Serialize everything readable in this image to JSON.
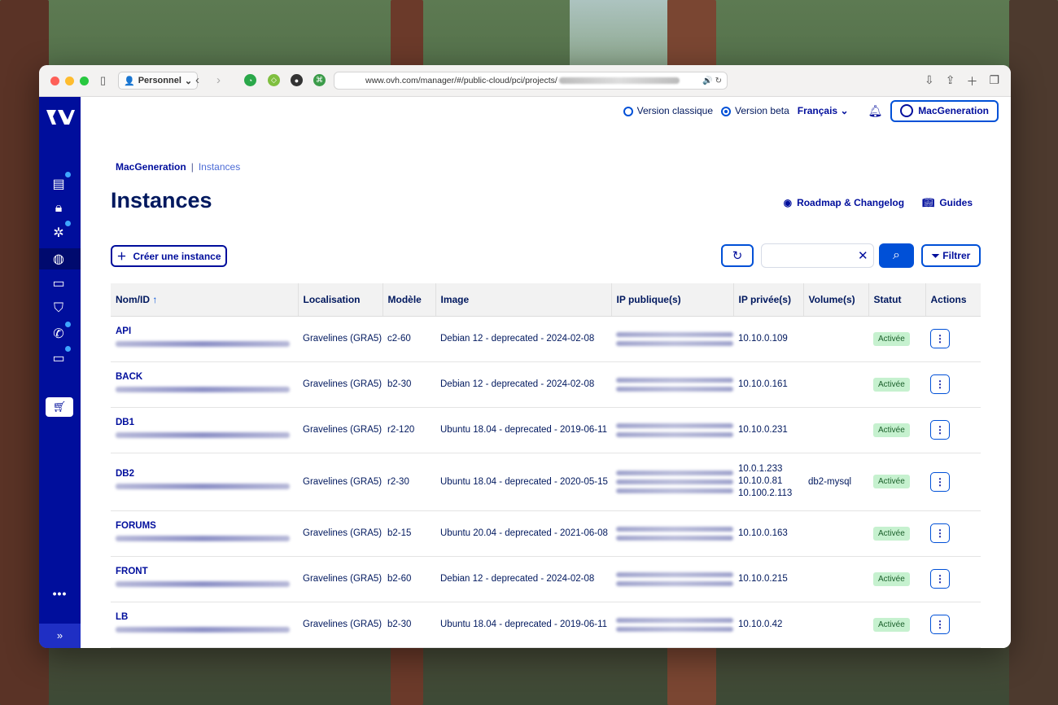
{
  "browser": {
    "profile": "Personnel",
    "url": "www.ovh.com/manager/#/public-cloud/pci/projects/"
  },
  "topbar": {
    "version_classic": "Version classique",
    "version_beta": "Version beta",
    "language": "Français",
    "account": "MacGeneration"
  },
  "breadcrumb": {
    "root": "MacGeneration",
    "separator": "|",
    "current": "Instances"
  },
  "page": {
    "title": "Instances",
    "roadmap_link": "Roadmap & Changelog",
    "guides_link": "Guides",
    "create_button": "Créer une instance",
    "filter_button": "Filtrer",
    "search_value": ""
  },
  "table": {
    "headers": [
      "Nom/ID",
      "Localisation",
      "Modèle",
      "Image",
      "IP publique(s)",
      "IP privée(s)",
      "Volume(s)",
      "Statut",
      "Actions"
    ],
    "sort_arrow": "↑",
    "rows": [
      {
        "name": "API",
        "location": "Gravelines (GRA5)",
        "model": "c2-60",
        "image": "Debian 12 - deprecated - 2024-02-08",
        "private_ips": [
          "10.10.0.109"
        ],
        "volumes": "",
        "status": "Activée"
      },
      {
        "name": "BACK",
        "location": "Gravelines (GRA5)",
        "model": "b2-30",
        "image": "Debian 12 - deprecated - 2024-02-08",
        "private_ips": [
          "10.10.0.161"
        ],
        "volumes": "",
        "status": "Activée"
      },
      {
        "name": "DB1",
        "location": "Gravelines (GRA5)",
        "model": "r2-120",
        "image": "Ubuntu 18.04 - deprecated - 2019-06-11",
        "private_ips": [
          "10.10.0.231"
        ],
        "volumes": "",
        "status": "Activée"
      },
      {
        "name": "DB2",
        "location": "Gravelines (GRA5)",
        "model": "r2-30",
        "image": "Ubuntu 18.04 - deprecated - 2020-05-15",
        "private_ips": [
          "10.0.1.233",
          "10.10.0.81",
          "10.100.2.113"
        ],
        "volumes": "db2-mysql",
        "status": "Activée"
      },
      {
        "name": "FORUMS",
        "location": "Gravelines (GRA5)",
        "model": "b2-15",
        "image": "Ubuntu 20.04 - deprecated - 2021-06-08",
        "private_ips": [
          "10.10.0.163"
        ],
        "volumes": "",
        "status": "Activée"
      },
      {
        "name": "FRONT",
        "location": "Gravelines (GRA5)",
        "model": "b2-60",
        "image": "Debian 12 - deprecated - 2024-02-08",
        "private_ips": [
          "10.10.0.215"
        ],
        "volumes": "",
        "status": "Activée"
      },
      {
        "name": "LB",
        "location": "Gravelines (GRA5)",
        "model": "b2-30",
        "image": "Ubuntu 18.04 - deprecated - 2019-06-11",
        "private_ips": [
          "10.10.0.42"
        ],
        "volumes": "",
        "status": "Activée"
      }
    ]
  },
  "sidebar": {
    "more_label": "•••",
    "expand_label": "»"
  },
  "colors": {
    "brand_blue": "#000e9c",
    "accent_blue": "#0050d7",
    "status_green_bg": "#c6f1cf"
  }
}
